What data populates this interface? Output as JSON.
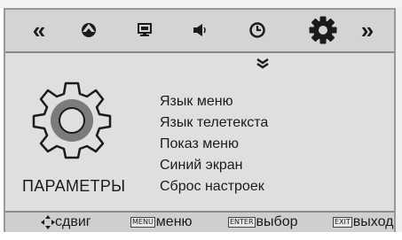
{
  "icon_bar": {
    "prev_label": "«",
    "next_label": "»",
    "icons": [
      "picture-icon",
      "pc-monitor-icon",
      "speaker-icon",
      "clock-icon",
      "gear-icon"
    ],
    "selected": "gear-icon"
  },
  "panel": {
    "title": "ПАРАМЕТРЫ",
    "menu_items": [
      "Язык меню",
      "Язык телетекста",
      "Показ меню",
      "Синий экран",
      "Сброс настроек"
    ]
  },
  "hints": [
    {
      "key": "",
      "label": "сдвиг"
    },
    {
      "key": "MENU",
      "label": "меню"
    },
    {
      "key": "ENTER",
      "label": "выбор"
    },
    {
      "key": "EXIT",
      "label": "выход"
    }
  ],
  "colors": {
    "background": "#dcdcdc",
    "bar": "#d4d4d4",
    "text": "#1b1b1b"
  }
}
